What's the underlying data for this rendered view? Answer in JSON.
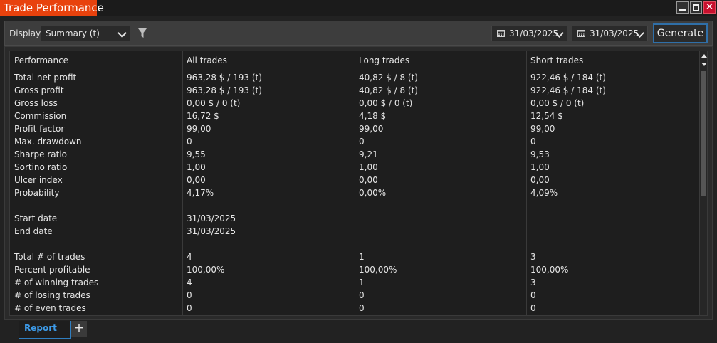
{
  "window": {
    "title": "Trade Performance"
  },
  "toolbar": {
    "display_label": "Display",
    "display_value": "Summary (t)",
    "date_from": "31/03/2025",
    "date_to": "31/03/2025",
    "generate_label": "Generate"
  },
  "grid": {
    "columns": [
      "Performance",
      "All trades",
      "Long trades",
      "Short trades"
    ],
    "rows": [
      [
        "Total net profit",
        "963,28 $ / 193 (t)",
        "40,82 $ / 8 (t)",
        "922,46 $ / 184 (t)"
      ],
      [
        "Gross profit",
        "963,28 $ / 193 (t)",
        "40,82 $ / 8 (t)",
        "922,46 $ / 184 (t)"
      ],
      [
        "Gross loss",
        "0,00 $ / 0 (t)",
        "0,00 $ / 0 (t)",
        "0,00 $ / 0 (t)"
      ],
      [
        "Commission",
        "16,72 $",
        "4,18 $",
        "12,54 $"
      ],
      [
        "Profit factor",
        "99,00",
        "99,00",
        "99,00"
      ],
      [
        "Max. drawdown",
        "0",
        "0",
        "0"
      ],
      [
        "Sharpe ratio",
        "9,55",
        "9,21",
        "9,53"
      ],
      [
        "Sortino ratio",
        "1,00",
        "1,00",
        "1,00"
      ],
      [
        "Ulcer index",
        "0,00",
        "0,00",
        "0,00"
      ],
      [
        "Probability",
        "4,17%",
        "0,00%",
        "4,09%"
      ],
      [
        "",
        "",
        "",
        ""
      ],
      [
        "Start date",
        "31/03/2025",
        "",
        ""
      ],
      [
        "End date",
        "31/03/2025",
        "",
        ""
      ],
      [
        "",
        "",
        "",
        ""
      ],
      [
        "Total # of trades",
        "4",
        "1",
        "3"
      ],
      [
        "Percent profitable",
        "100,00%",
        "100,00%",
        "100,00%"
      ],
      [
        "# of winning trades",
        "4",
        "1",
        "3"
      ],
      [
        "# of losing trades",
        "0",
        "0",
        "0"
      ],
      [
        "# of even trades",
        "0",
        "0",
        "0"
      ]
    ]
  },
  "tabs": {
    "report_label": "Report",
    "add_label": "+"
  },
  "colors": {
    "title_accent": "#e8420d",
    "tab_accent": "#3d9be9",
    "close_button": "#c8102e"
  },
  "icons": [
    "minimize-icon",
    "maximize-icon",
    "close-icon",
    "chevron-down-icon",
    "filter-icon",
    "calendar-icon",
    "scroll-up-icon",
    "scroll-down-icon"
  ]
}
